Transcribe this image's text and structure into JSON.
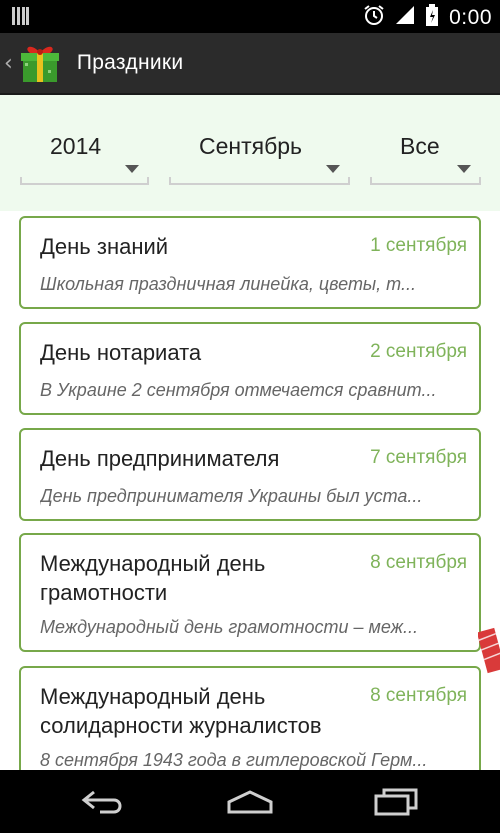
{
  "status_bar": {
    "time": "0:00"
  },
  "action_bar": {
    "title": "Праздники"
  },
  "filters": {
    "year": "2014",
    "month": "Сентябрь",
    "category": "Все"
  },
  "holidays": [
    {
      "title": "День знаний",
      "date": "1 сентября",
      "description": "Школьная праздничная линейка, цветы, т..."
    },
    {
      "title": "День нотариата",
      "date": "2 сентября",
      "description": "В Украине 2 сентября отмечается сравнит..."
    },
    {
      "title": "День предпринимателя",
      "date": "7 сентября",
      "description": "День предпринимателя Украины был уста..."
    },
    {
      "title": "Международный день грамотности",
      "date": "8 сентября",
      "description": "Международный день грамотности – меж..."
    },
    {
      "title": "Международный день солидарности журналистов",
      "date": "8 сентября",
      "description": "8 сентября 1943 года в гитлеровской Герм..."
    }
  ],
  "colors": {
    "accent_green": "#77a84a",
    "date_green": "#7fb35a",
    "filter_bg": "#effaee",
    "action_bar_bg": "#2b2b2b"
  },
  "icons": {
    "app": "gift-icon",
    "up": "chevron-left-icon",
    "alarm": "alarm-icon",
    "signal": "signal-icon",
    "battery": "battery-icon",
    "notification": "notification-icon",
    "back": "back-icon",
    "home": "home-icon",
    "recents": "recents-icon"
  }
}
